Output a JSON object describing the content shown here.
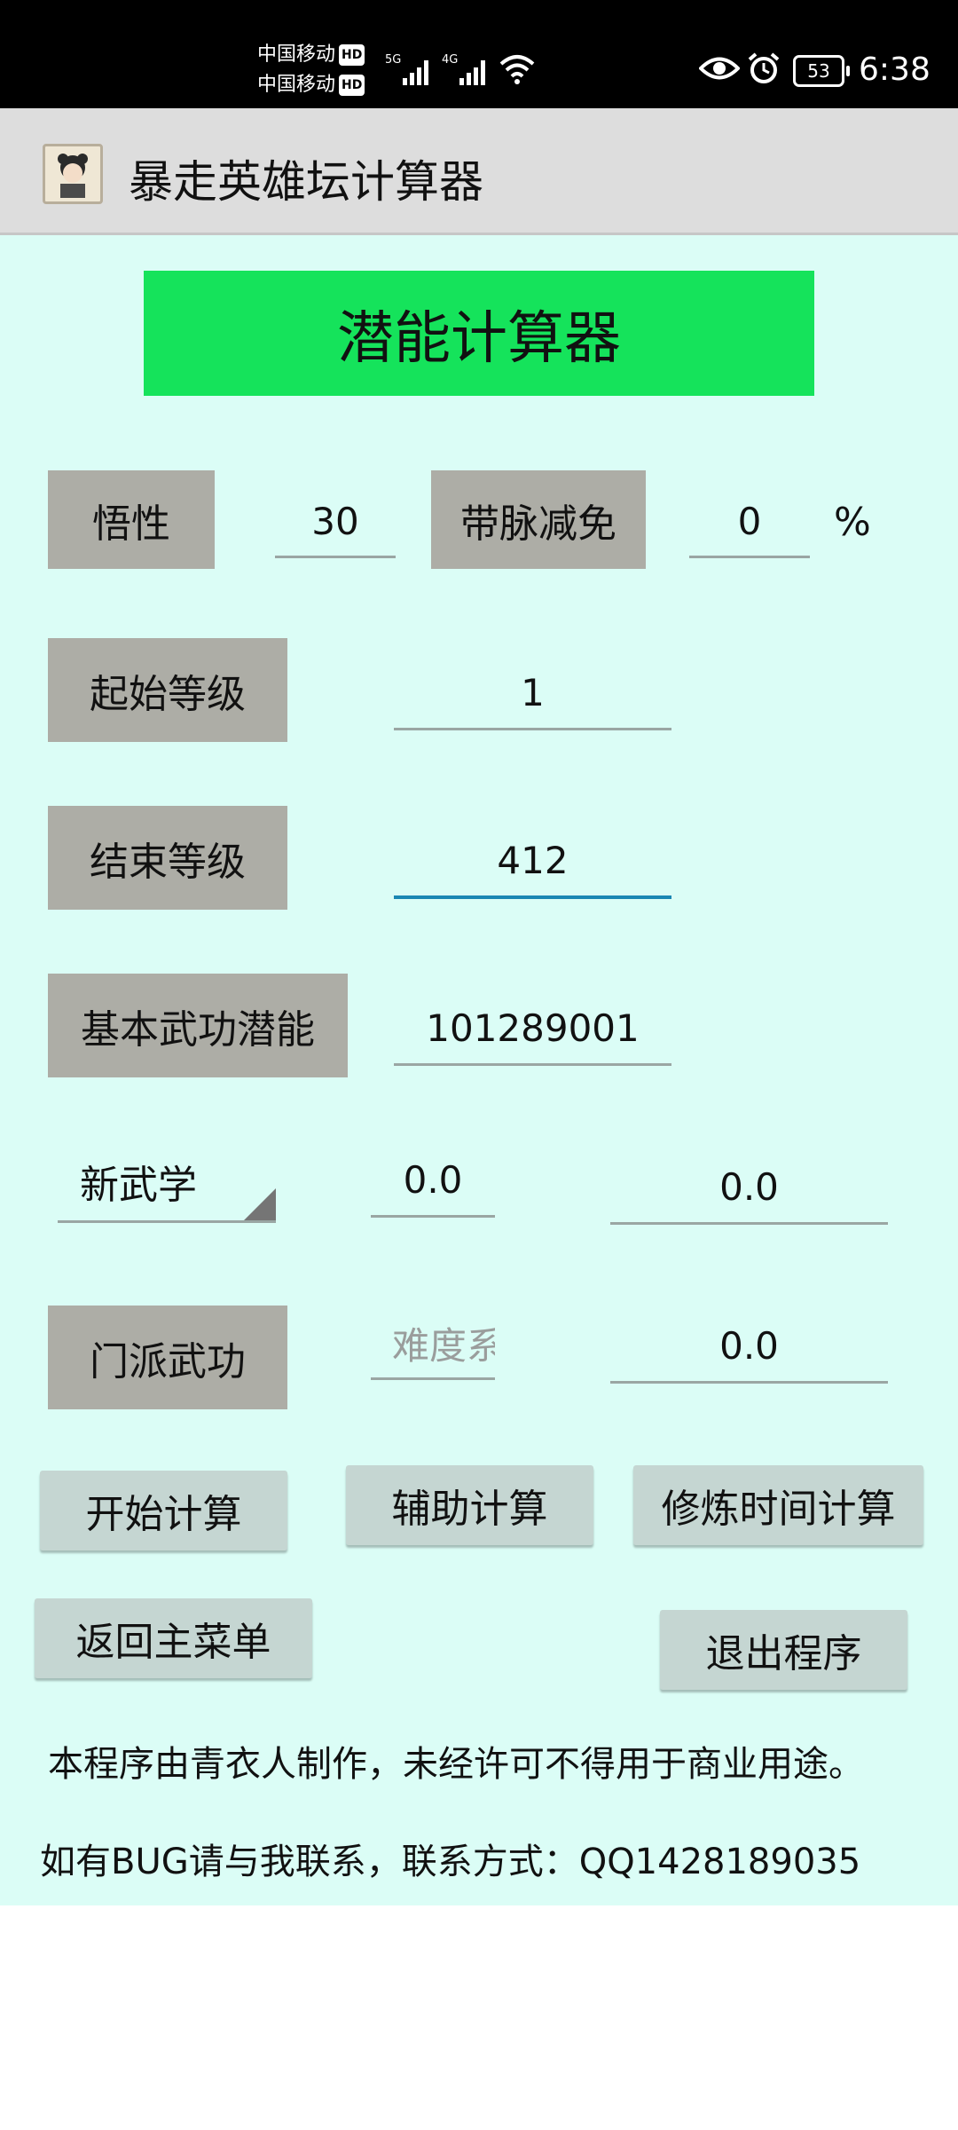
{
  "status_bar": {
    "carrier_1": "中国移动",
    "carrier_2": "中国移动",
    "hd": "HD",
    "net_1": "5G",
    "net_2": "4G",
    "battery": "53",
    "time": "6:38",
    "icons": [
      "eye-icon",
      "alarm-icon",
      "wifi-icon",
      "signal-icon"
    ]
  },
  "action_bar": {
    "title": "暴走英雄坛计算器"
  },
  "main": {
    "header_button": "潜能计算器",
    "header_color": "#15e35b",
    "row1": {
      "label_a": "悟性",
      "value_a": "30",
      "label_b": "带脉减免",
      "value_b": "0",
      "unit": "%"
    },
    "row2": {
      "label": "起始等级",
      "value": "1"
    },
    "row3": {
      "label": "结束等级",
      "value": "412"
    },
    "row4": {
      "label": "基本武功潜能",
      "value": "101289001"
    },
    "row5": {
      "select_value": "新武学",
      "value_a": "0.0",
      "value_b": "0.0"
    },
    "row6": {
      "label": "门派武功",
      "placeholder": "难度系",
      "value_b": "0.0"
    },
    "buttons": {
      "start": "开始计算",
      "assist": "辅助计算",
      "practice_time": "修炼时间计算",
      "back": "返回主菜单",
      "exit": "退出程序"
    },
    "notice_1": "本程序由青衣人制作，未经许可不得用于商业用途。",
    "notice_2": "如有BUG请与我联系，联系方式：QQ1428189035"
  }
}
